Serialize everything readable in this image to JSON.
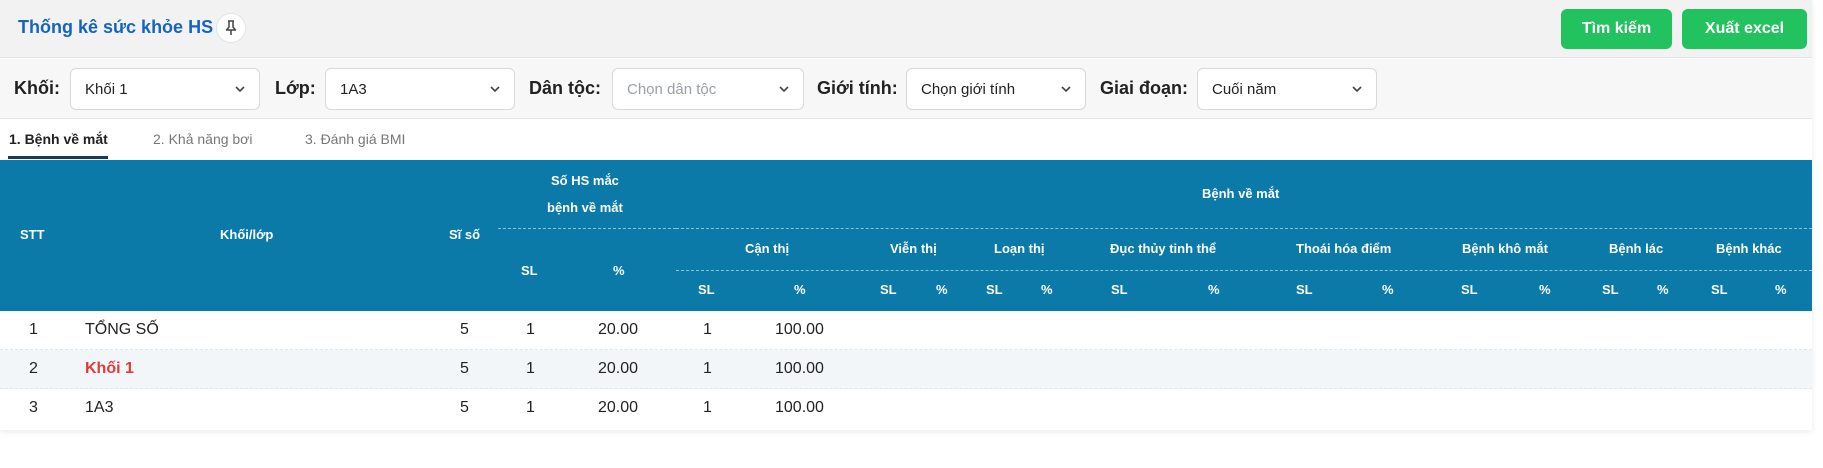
{
  "header": {
    "title": "Thống kê sức khỏe HS",
    "search_button": "Tìm kiếm",
    "export_button": "Xuất excel"
  },
  "filters": {
    "khoi": {
      "label": "Khối:",
      "value": "Khối 1"
    },
    "lop": {
      "label": "Lớp:",
      "value": "1A3"
    },
    "dan_toc": {
      "label": "Dân tộc:",
      "placeholder": "Chọn dân tộc"
    },
    "gioi_tinh": {
      "label": "Giới tính:",
      "placeholder": "Chọn giới tính"
    },
    "giai_doan": {
      "label": "Giai đoạn:",
      "value": "Cuối năm"
    }
  },
  "tabs": [
    "1. Bệnh về mắt",
    "2. Khả năng bơi",
    "3. Đánh giá BMI"
  ],
  "table": {
    "headers": {
      "stt": "STT",
      "khoi_lop": "Khối/lớp",
      "si_so": "Sĩ số",
      "so_hs_line1": "Số HS mắc",
      "so_hs_line2": "bệnh về mắt",
      "benh_ve_mat": "Bệnh về mắt",
      "groups": [
        "Cận thị",
        "Viễn thị",
        "Loạn thị",
        "Đục thủy tinh thể",
        "Thoái hóa điểm",
        "Bệnh khô mắt",
        "Bệnh lác",
        "Bệnh khác"
      ],
      "sl": "SL",
      "pct": "%"
    },
    "rows": [
      {
        "stt": "1",
        "name": "TỔNG SỐ",
        "si_so": "5",
        "sl": "1",
        "pct": "20.00",
        "can_thi_sl": "1",
        "can_thi_pct": "100.00"
      },
      {
        "stt": "2",
        "name": "Khối 1",
        "si_so": "5",
        "sl": "1",
        "pct": "20.00",
        "can_thi_sl": "1",
        "can_thi_pct": "100.00"
      },
      {
        "stt": "3",
        "name": "1A3",
        "si_so": "5",
        "sl": "1",
        "pct": "20.00",
        "can_thi_sl": "1",
        "can_thi_pct": "100.00"
      }
    ]
  },
  "colors": {
    "accent": "#22c25f",
    "header_bg": "#0b7aa9",
    "title": "#1565c0",
    "highlight": "#e53935"
  }
}
